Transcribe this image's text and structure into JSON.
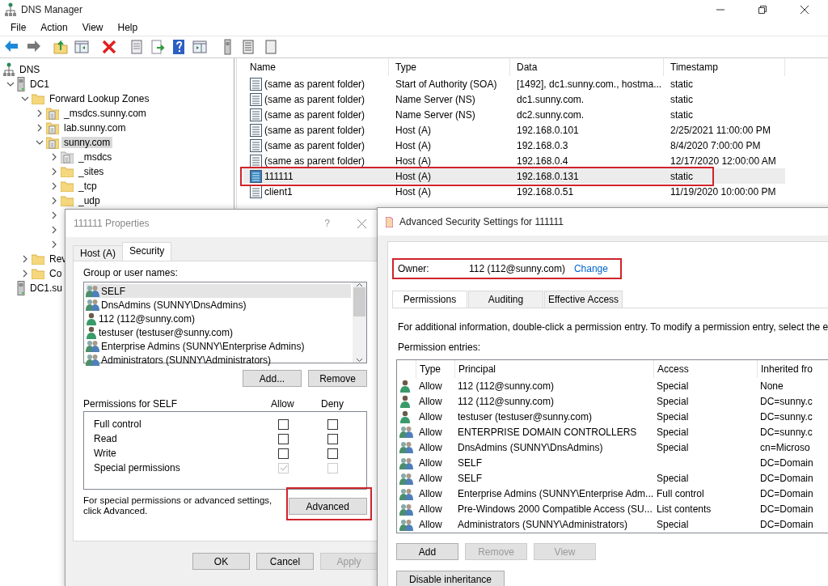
{
  "window": {
    "title": "DNS Manager"
  },
  "menu": [
    "File",
    "Action",
    "View",
    "Help"
  ],
  "tree": [
    {
      "label": "DNS",
      "kind": "dns",
      "children": [
        {
          "label": "DC1",
          "kind": "server",
          "expanded": true,
          "children": [
            {
              "label": "Forward Lookup Zones",
              "kind": "folder",
              "expanded": true,
              "children": [
                {
                  "label": "_msdcs.sunny.com",
                  "kind": "zone",
                  "expanded": false
                },
                {
                  "label": "lab.sunny.com",
                  "kind": "zone",
                  "expanded": false
                },
                {
                  "label": "sunny.com",
                  "kind": "zone",
                  "expanded": true,
                  "selected": true,
                  "children": [
                    {
                      "label": "_msdcs",
                      "kind": "subzone",
                      "expanded": false
                    },
                    {
                      "label": "_sites",
                      "kind": "folder",
                      "expanded": false
                    },
                    {
                      "label": "_tcp",
                      "kind": "folder",
                      "expanded": false
                    },
                    {
                      "label": "_udp",
                      "kind": "folder",
                      "expanded": false
                    },
                    {
                      "kind": "hidden",
                      "expanded": false
                    },
                    {
                      "kind": "hidden",
                      "expanded": false
                    },
                    {
                      "kind": "hidden",
                      "expanded": false
                    }
                  ]
                }
              ]
            },
            {
              "label": "Rev",
              "kind": "folder",
              "expanded": false
            },
            {
              "label": "Co",
              "kind": "folder",
              "expanded": false
            }
          ]
        },
        {
          "label": "DC1.su",
          "kind": "server"
        }
      ]
    }
  ],
  "records": {
    "columns": [
      "Name",
      "Type",
      "Data",
      "Timestamp"
    ],
    "rows": [
      {
        "name": "(same as parent folder)",
        "type": "Start of Authority (SOA)",
        "data": "[1492], dc1.sunny.com., hostma...",
        "timestamp": "static",
        "selected": false
      },
      {
        "name": "(same as parent folder)",
        "type": "Name Server (NS)",
        "data": "dc1.sunny.com.",
        "timestamp": "static",
        "selected": false
      },
      {
        "name": "(same as parent folder)",
        "type": "Name Server (NS)",
        "data": "dc2.sunny.com.",
        "timestamp": "static",
        "selected": false
      },
      {
        "name": "(same as parent folder)",
        "type": "Host (A)",
        "data": "192.168.0.101",
        "timestamp": "2/25/2021 11:00:00 PM",
        "selected": false
      },
      {
        "name": "(same as parent folder)",
        "type": "Host (A)",
        "data": "192.168.0.3",
        "timestamp": "8/4/2020 7:00:00 PM",
        "selected": false
      },
      {
        "name": "(same as parent folder)",
        "type": "Host (A)",
        "data": "192.168.0.4",
        "timestamp": "12/17/2020 12:00:00 AM",
        "selected": false
      },
      {
        "name": "111111",
        "type": "Host (A)",
        "data": "192.168.0.131",
        "timestamp": "static",
        "selected": true,
        "annotated": true
      },
      {
        "name": "client1",
        "type": "Host (A)",
        "data": "192.168.0.51",
        "timestamp": "11/19/2020 10:00:00 PM",
        "selected": false
      }
    ]
  },
  "properties": {
    "title": "111111 Properties",
    "help": "?",
    "tabs": [
      {
        "label": "Host (A)",
        "selected": false
      },
      {
        "label": "Security",
        "selected": true
      }
    ],
    "group_label": "Group or user names:",
    "principals": [
      {
        "name": "SELF",
        "kind": "group",
        "selected": true
      },
      {
        "name": "DnsAdmins (SUNNY\\DnsAdmins)",
        "kind": "group",
        "selected": false
      },
      {
        "name": "112 (112@sunny.com)",
        "kind": "user",
        "selected": false
      },
      {
        "name": "testuser (testuser@sunny.com)",
        "kind": "user",
        "selected": false
      },
      {
        "name": "Enterprise Admins (SUNNY\\Enterprise Admins)",
        "kind": "group",
        "selected": false
      },
      {
        "name": "Administrators (SUNNY\\Administrators)",
        "kind": "group",
        "selected": false
      }
    ],
    "list_buttons": [
      "Add...",
      "Remove"
    ],
    "permissions_label": "Permissions for SELF",
    "allow_label": "Allow",
    "deny_label": "Deny",
    "permissions": [
      {
        "name": "Full control",
        "allow": false,
        "deny": false,
        "disabled": false
      },
      {
        "name": "Read",
        "allow": false,
        "deny": false,
        "disabled": false
      },
      {
        "name": "Write",
        "allow": false,
        "deny": false,
        "disabled": false
      },
      {
        "name": "Special permissions",
        "allow": true,
        "deny": false,
        "disabled": true
      }
    ],
    "advanced_note": "For special permissions or advanced settings, click Advanced.",
    "advanced": {
      "label": "Advanced",
      "annotated": true
    },
    "footer": [
      {
        "label": "OK",
        "disabled": false
      },
      {
        "label": "Cancel",
        "disabled": false
      },
      {
        "label": "Apply",
        "disabled": true
      }
    ]
  },
  "advanced": {
    "title": "Advanced Security Settings for 111111",
    "owner": {
      "label": "Owner:",
      "value": "112 (112@sunny.com)",
      "link": "Change",
      "annotated": true
    },
    "tabs": [
      {
        "label": "Permissions",
        "selected": true
      },
      {
        "label": "Auditing",
        "selected": false
      },
      {
        "label": "Effective Access",
        "selected": false
      }
    ],
    "info": "For additional information, double-click a permission entry. To modify a permission entry, select the e",
    "entries_label": "Permission entries:",
    "columns": [
      "Type",
      "Principal",
      "Access",
      "Inherited fro"
    ],
    "entries": [
      {
        "kind": "user",
        "type": "Allow",
        "principal": "112 (112@sunny.com)",
        "access": "Special",
        "inherited": "None"
      },
      {
        "kind": "user",
        "type": "Allow",
        "principal": "112 (112@sunny.com)",
        "access": "Special",
        "inherited": "DC=sunny.c"
      },
      {
        "kind": "user",
        "type": "Allow",
        "principal": "testuser (testuser@sunny.com)",
        "access": "Special",
        "inherited": "DC=sunny.c"
      },
      {
        "kind": "group",
        "type": "Allow",
        "principal": "ENTERPRISE DOMAIN CONTROLLERS",
        "access": "Special",
        "inherited": "DC=sunny.c"
      },
      {
        "kind": "group",
        "type": "Allow",
        "principal": "DnsAdmins (SUNNY\\DnsAdmins)",
        "access": "Special",
        "inherited": "cn=Microso"
      },
      {
        "kind": "group",
        "type": "Allow",
        "principal": "SELF",
        "inherited": "DC=Domain"
      },
      {
        "kind": "group",
        "type": "Allow",
        "principal": "SELF",
        "access": "Special",
        "inherited": "DC=Domain"
      },
      {
        "kind": "group",
        "type": "Allow",
        "principal": "Enterprise Admins (SUNNY\\Enterprise Adm...",
        "access": "Full control",
        "inherited": "DC=Domain"
      },
      {
        "kind": "group",
        "type": "Allow",
        "principal": "Pre-Windows 2000 Compatible Access (SU...",
        "access": "List contents",
        "inherited": "DC=Domain"
      },
      {
        "kind": "group",
        "type": "Allow",
        "principal": "Administrators (SUNNY\\Administrators)",
        "access": "Special",
        "inherited": "DC=Domain"
      }
    ],
    "buttons": [
      {
        "label": "Add",
        "disabled": false
      },
      {
        "label": "Remove",
        "disabled": true
      },
      {
        "label": "View",
        "disabled": true
      }
    ],
    "disable_inheritance": "Disable inheritance"
  }
}
